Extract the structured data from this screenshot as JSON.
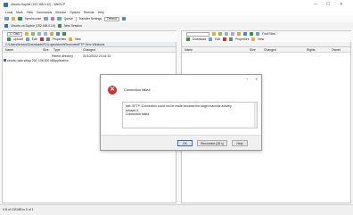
{
  "window": {
    "title": "Ubuntu Sophie (192.168.0.10) - WinSCP",
    "minimize_glyph": "—",
    "maximize_glyph": "☐",
    "close_glyph": "✕"
  },
  "menubar": [
    "Local",
    "Mark",
    "Files",
    "Commands",
    "Session",
    "Options",
    "Remote",
    "Help"
  ],
  "toolbar1": {
    "synchronize_label": "Synchronize",
    "queue_label": "Queue",
    "transfer_settings_label": "Transfer Settings",
    "transfer_settings_value": "Default"
  },
  "session_tab": {
    "label": "Ubuntu va Sophie (192.168.0.10)",
    "new_session_label": "New Session"
  },
  "left_pane": {
    "drive": "C: Disk",
    "upload_label": "Upload",
    "edit_label": "Edit",
    "properties_label": "Properties",
    "new_label": "New",
    "path": "C:\\Users\\lenovo\\Downloads\\FL\\Logs\\Admin\\Rerunned\\FTP Serv Windows",
    "columns": [
      "Name",
      "Size",
      "Type",
      "Changed"
    ],
    "rows": [
      {
        "name": "..",
        "size": "",
        "type": "Parent directory",
        "changed": "31/10/2022 23:44:33"
      },
      {
        "name": "ubuntu sata setup 202...",
        "size": "136,000 kB",
        "type": "Application",
        "changed": ""
      }
    ],
    "status": "0 B of 135 MB in 0 of 1"
  },
  "right_pane": {
    "download_label": "Download",
    "edit_label": "Edit",
    "properties_label": "Properties",
    "new_label": "New",
    "find_files_label": "Find Files",
    "columns": [
      "Name",
      "Size",
      "Changed",
      "Rights",
      "Owner"
    ]
  },
  "dialog": {
    "title": "?",
    "heading": "Connection failed.",
    "message_lines": [
      "Net::SFTP::Connection could not be made because the target machine actively",
      "refused it.",
      "Connection failed."
    ],
    "buttons": {
      "ok": "OK",
      "reconnect": "Reconnect (28 s)",
      "help": "Help"
    }
  },
  "colors": {
    "accent": "#2f6fbf",
    "error": "#d32f2f",
    "path_bg": "#e9eef6"
  }
}
